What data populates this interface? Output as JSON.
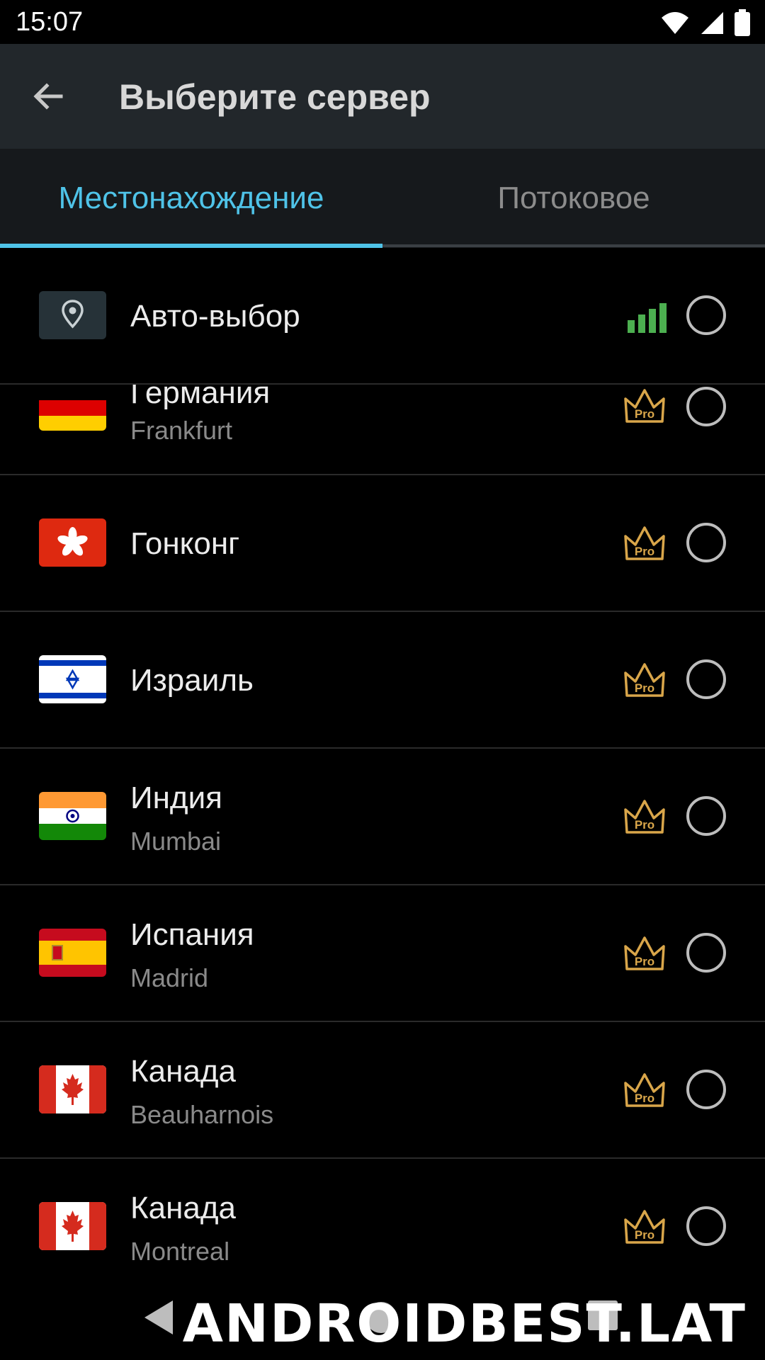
{
  "status_bar": {
    "time": "15:07",
    "icons": [
      "wifi-icon",
      "signal-icon",
      "battery-icon"
    ]
  },
  "app_bar": {
    "back_icon": "back-arrow-icon",
    "title": "Выберите сервер"
  },
  "tabs": [
    {
      "label": "Местонахождение",
      "active": true
    },
    {
      "label": "Потоковое",
      "active": false
    }
  ],
  "colors": {
    "accent": "#4fc3e8",
    "signal_green": "#4caf50",
    "pro_gold": "#d9a64a"
  },
  "servers": [
    {
      "country": "Авто-выбор",
      "city": "",
      "icon": "location-pin-icon",
      "badge": "signal-strength-icon"
    },
    {
      "country": "Германия",
      "city": "Frankfurt",
      "icon": "germany-flag",
      "badge": "Pro"
    },
    {
      "country": "Гонконг",
      "city": "",
      "icon": "hong-kong-flag",
      "badge": "Pro"
    },
    {
      "country": "Израиль",
      "city": "",
      "icon": "israel-flag",
      "badge": "Pro"
    },
    {
      "country": "Индия",
      "city": "Mumbai",
      "icon": "india-flag",
      "badge": "Pro"
    },
    {
      "country": "Испания",
      "city": "Madrid",
      "icon": "spain-flag",
      "badge": "Pro"
    },
    {
      "country": "Канада",
      "city": "Beauharnois",
      "icon": "canada-flag",
      "badge": "Pro"
    },
    {
      "country": "Канада",
      "city": "Montreal",
      "icon": "canada-flag",
      "badge": "Pro"
    }
  ],
  "watermark": "ANDROIDBEST.LAT"
}
